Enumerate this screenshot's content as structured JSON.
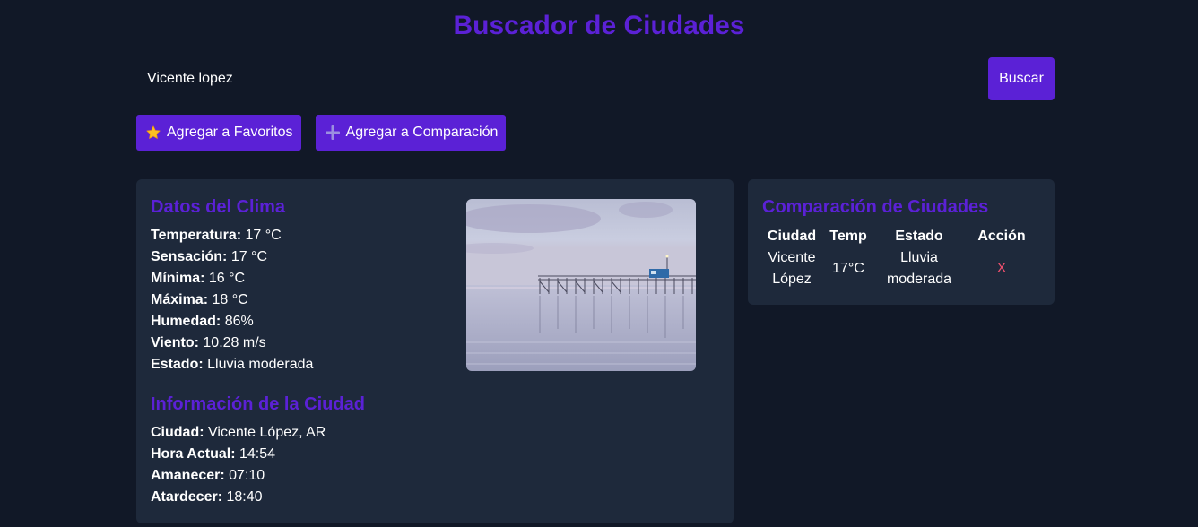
{
  "header": {
    "title": "Buscador de Ciudades"
  },
  "search": {
    "value": "Vicente lopez",
    "button_label": "Buscar"
  },
  "actions": {
    "favorites_label": "Agregar a Favoritos",
    "favorites_icon": "star-icon",
    "compare_label": "Agregar a Comparación",
    "compare_icon": "plus-icon"
  },
  "weather": {
    "title": "Datos del Clima",
    "rows": [
      {
        "label": "Temperatura:",
        "value": "17 °C"
      },
      {
        "label": "Sensación:",
        "value": "17 °C"
      },
      {
        "label": "Mínima:",
        "value": "16 °C"
      },
      {
        "label": "Máxima:",
        "value": "18 °C"
      },
      {
        "label": "Humedad:",
        "value": "86%"
      },
      {
        "label": "Viento:",
        "value": "10.28 m/s"
      },
      {
        "label": "Estado:",
        "value": "Lluvia moderada"
      }
    ]
  },
  "city": {
    "title": "Información de la Ciudad",
    "rows": [
      {
        "label": "Ciudad:",
        "value": "Vicente López, AR"
      },
      {
        "label": "Hora Actual:",
        "value": "14:54"
      },
      {
        "label": "Amanecer:",
        "value": "07:10"
      },
      {
        "label": "Atardecer:",
        "value": "18:40"
      }
    ]
  },
  "comparison": {
    "title": "Comparación de Ciudades",
    "headers": [
      "Ciudad",
      "Temp",
      "Estado",
      "Acción"
    ],
    "rows": [
      {
        "city": "Vicente López",
        "temp": "17°C",
        "status": "Lluvia moderada",
        "action": "X"
      }
    ]
  },
  "colors": {
    "background": "#111827",
    "panel": "#1e293b",
    "accent": "#5b21d6",
    "remove": "#f0506e"
  }
}
